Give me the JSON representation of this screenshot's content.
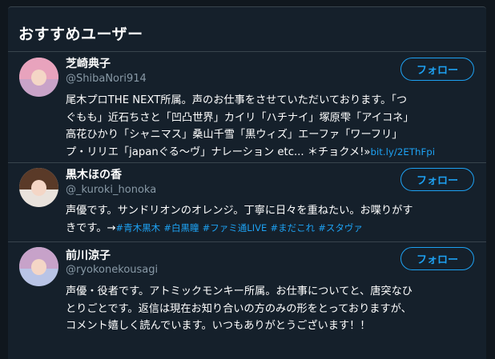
{
  "panel": {
    "title": "おすすめユーザー"
  },
  "users": [
    {
      "name": "芝崎典子",
      "handle": "@ShibaNori914",
      "follow_label": "フォロー",
      "bio_lines": [
        "尾木プロTHE NEXT所属。声のお仕事をさせていただいております。「つ",
        "ぐもも」近石ちさと「凹凸世界」カイリ「ハチナイ」塚原雫「アイコネ」",
        "高花ひかり「シャニマス」桑山千雪「黒ウィズ」エーファ「ワーフリ」",
        "プ・リリエ「japanぐる〜ヴ」ナレーション etc... ＊チョクメ!»"
      ],
      "bio_link": "bit.ly/2EThFpi",
      "avatar_colors": {
        "hair": "#e8a3bd",
        "bg": "#c9a3c8"
      }
    },
    {
      "name": "黒木ほの香",
      "handle": "@_kuroki_honoka",
      "follow_label": "フォロー",
      "bio_lines": [
        "声優です。サンドリオンのオレンジ。丁寧に日々を重ねたい。お喋りがす",
        "きです。→"
      ],
      "bio_tags": [
        "#青木黒木",
        "#白黒瞳",
        "#ファミ通LIVE",
        "#まだこれ",
        "#スタヴァ"
      ],
      "avatar_colors": {
        "hair": "#5a3a28",
        "bg": "#e9e2dc"
      }
    },
    {
      "name": "前川涼子",
      "handle": "@ryokonekousagi",
      "follow_label": "フォロー",
      "bio_lines": [
        "声優・役者です。アトミックモンキー所属。お仕事についてと、唐突なひ",
        "とりごとです。返信は現在お知り合いの方のみの形をとっておりますが、",
        "コメント嬉しく読んでいます。いつもありがとうございます！！"
      ],
      "avatar_colors": {
        "hair": "#c7a2c9",
        "bg": "#b9c4e6"
      }
    }
  ],
  "colors": {
    "background": "#10171e",
    "panel": "#15202b",
    "divider": "#38444d",
    "accent": "#1da1f2",
    "muted_text": "#8899a6"
  }
}
